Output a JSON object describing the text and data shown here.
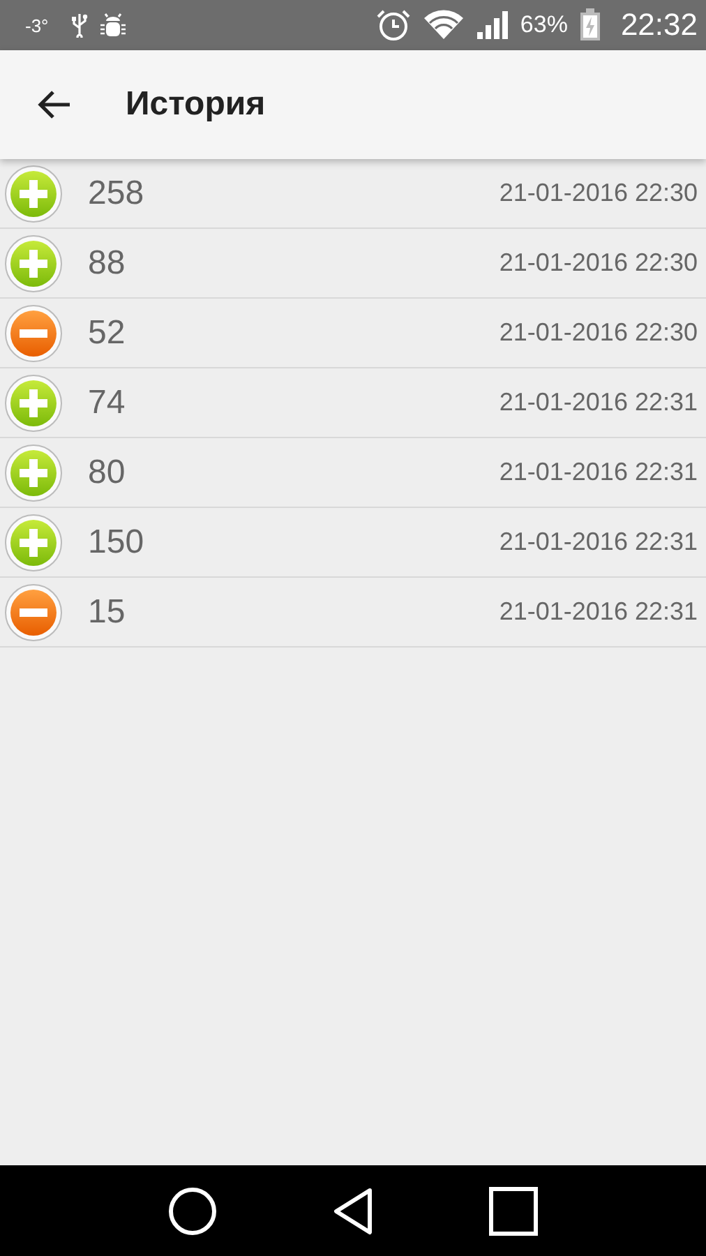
{
  "status_bar": {
    "temperature": "-3°",
    "battery": "63%",
    "time": "22:32"
  },
  "app_bar": {
    "title": "История"
  },
  "entries": [
    {
      "kind": "plus",
      "amount": "258",
      "datetime": "21-01-2016 22:30"
    },
    {
      "kind": "plus",
      "amount": "88",
      "datetime": "21-01-2016 22:30"
    },
    {
      "kind": "minus",
      "amount": "52",
      "datetime": "21-01-2016 22:30"
    },
    {
      "kind": "plus",
      "amount": "74",
      "datetime": "21-01-2016 22:31"
    },
    {
      "kind": "plus",
      "amount": "80",
      "datetime": "21-01-2016 22:31"
    },
    {
      "kind": "plus",
      "amount": "150",
      "datetime": "21-01-2016 22:31"
    },
    {
      "kind": "minus",
      "amount": "15",
      "datetime": "21-01-2016 22:31"
    }
  ]
}
